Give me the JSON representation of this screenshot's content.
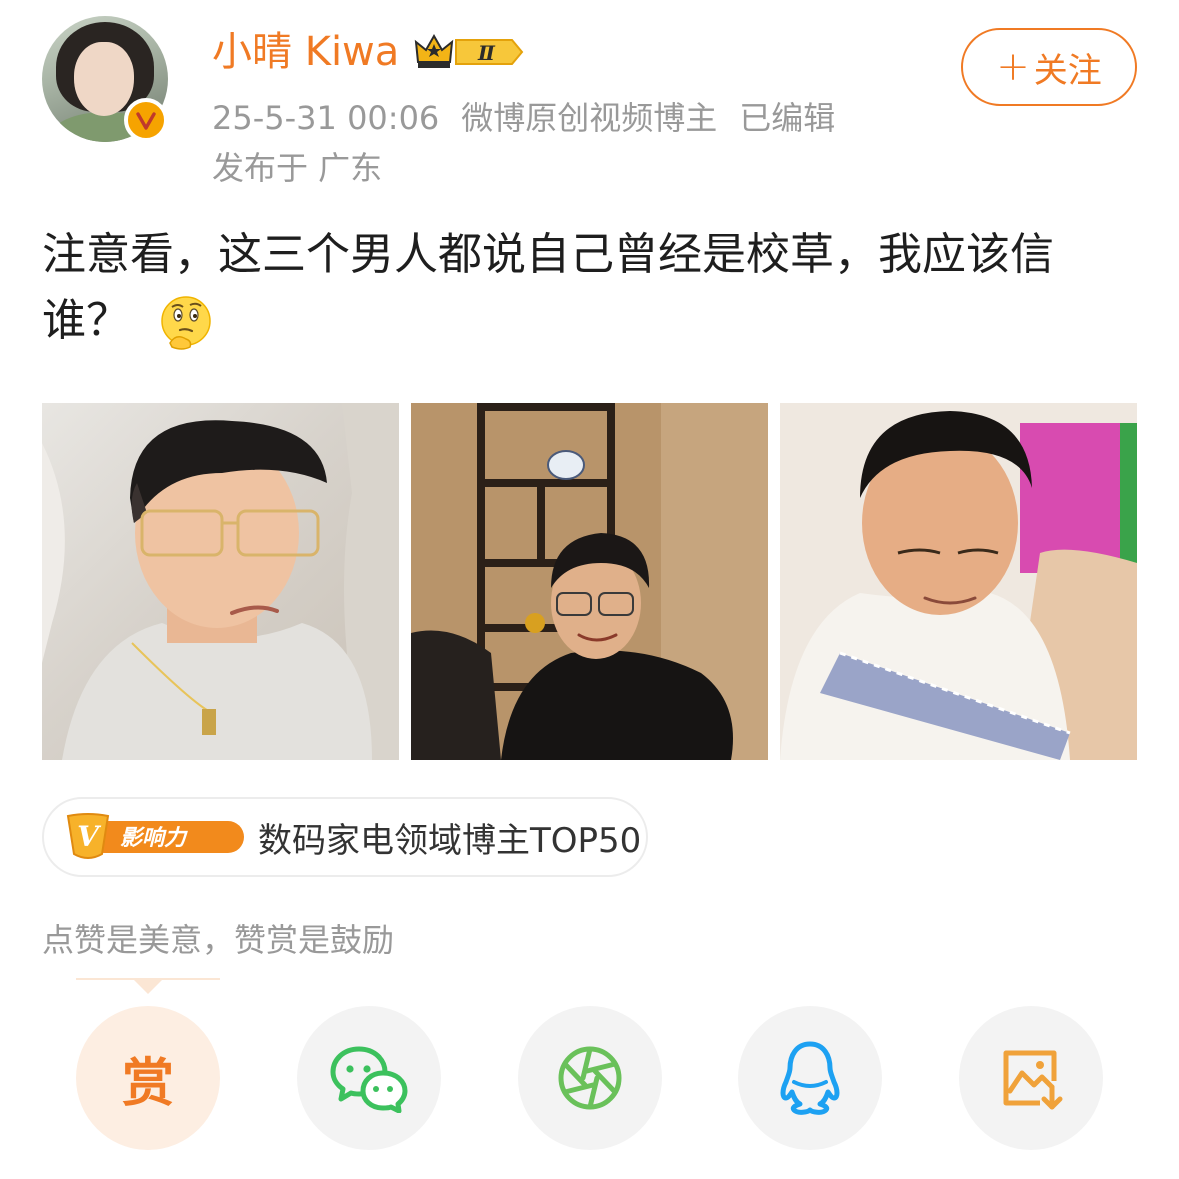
{
  "author": {
    "name": "小晴 Kiwa",
    "verified_badge": "v-badge-icon",
    "member_level": "Ⅱ"
  },
  "meta": {
    "timestamp": "25-5-31 00:06",
    "source": "微博原创视频博主",
    "edited": "已编辑",
    "location": "发布于 广东"
  },
  "follow_button": {
    "plus": "+",
    "label": "关注"
  },
  "post": {
    "text": "注意看，这三个男人都说自己曾经是校草，我应该信谁？",
    "emoji": "thinking-face-icon"
  },
  "photos": [
    {
      "alt": "man-with-glasses-white-shirt"
    },
    {
      "alt": "man-black-shirt-by-shelf"
    },
    {
      "alt": "man-white-collar-shirt"
    }
  ],
  "influence": {
    "badge_text": "影响力",
    "badge_letter": "V",
    "text": "数码家电领域博主TOP50"
  },
  "reward_hint": "点赞是美意，赞赏是鼓励",
  "share_row": [
    {
      "name": "reward",
      "label": "赏"
    },
    {
      "name": "wechat",
      "icon": "wechat-icon"
    },
    {
      "name": "moments",
      "icon": "wechat-moments-icon"
    },
    {
      "name": "qq",
      "icon": "qq-icon"
    },
    {
      "name": "save-image",
      "icon": "save-image-icon"
    }
  ],
  "colors": {
    "accent": "#f07a24",
    "wechat_green": "#3cc15d",
    "qq_blue": "#1da1f2",
    "save_orange": "#f0a23a"
  }
}
